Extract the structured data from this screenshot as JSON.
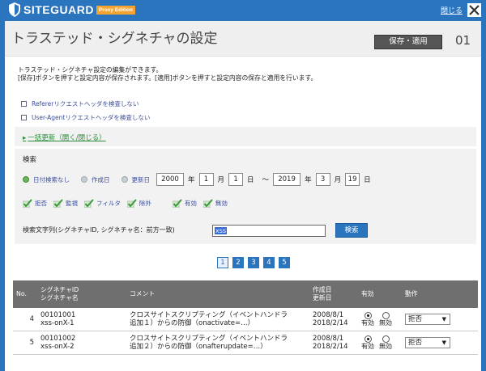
{
  "brand": {
    "name": "SITEGUARD",
    "edition": "Proxy Edition"
  },
  "header": {
    "close_label": "閉じる"
  },
  "page": {
    "title": "トラステッド・シグネチャの設定",
    "save_apply_label": "保存・適用",
    "step": "01",
    "desc_line1": "トラステッド・シグネチャ設定の編集ができます。",
    "desc_line2": "[保存]ボタンを押すと設定内容が保存されます。[適用]ボタンを押すと設定内容の保存と適用を行います。"
  },
  "options": {
    "referer": "Refererリクエストヘッダを検査しない",
    "user_agent": "User-Agentリクエストヘッダを検査しない"
  },
  "bulk_update_label": "一括更新（開く/閉じる）",
  "search": {
    "title": "検索",
    "date_modes": [
      "日付検索なし",
      "作成日",
      "更新日"
    ],
    "from": {
      "year": "2000",
      "month": "1",
      "day": "1"
    },
    "to": {
      "year": "2019",
      "month": "3",
      "day": "19"
    },
    "unit_year": "年",
    "unit_month": "月",
    "unit_day": "日",
    "tilde": "～",
    "flags": [
      "拒否",
      "監視",
      "フィルタ",
      "除外",
      "有効",
      "無効"
    ],
    "keyword_label": "検索文字列(シグネチャID, シグネチャ名：前方一致)",
    "keyword_value": "xss",
    "button": "検索"
  },
  "pager": [
    "1",
    "2",
    "3",
    "4",
    "5"
  ],
  "table": {
    "headers": {
      "no": "No.",
      "sig_id": "シグネチャID",
      "sig_name": "シグネチャ名",
      "comment": "コメント",
      "created": "作成日",
      "updated": "更新日",
      "enabled": "有効",
      "action": "動作"
    },
    "rows": [
      {
        "no": "4",
        "id": "00101001",
        "name": "xss-onX-1",
        "comment1": "クロスサイトスクリプティング（イベントハンドラ",
        "comment2": "追加１）からの防御（onactivate=…）",
        "created": "2008/8/1",
        "updated": "2018/2/14",
        "on_label": "有効",
        "off_label": "無効",
        "action": "拒否"
      },
      {
        "no": "5",
        "id": "00101002",
        "name": "xss-onX-2",
        "comment1": "クロスサイトスクリプティング（イベントハンドラ",
        "comment2": "追加２）からの防御（onafterupdate=…）",
        "created": "2008/8/1",
        "updated": "2018/2/14",
        "on_label": "有効",
        "off_label": "無効",
        "action": "拒否"
      }
    ]
  }
}
